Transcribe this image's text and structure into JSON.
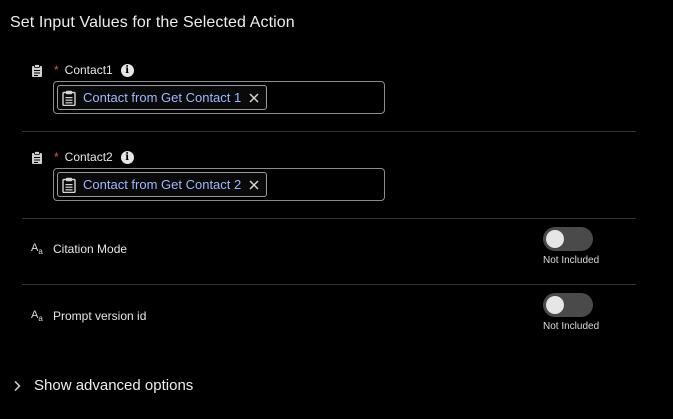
{
  "header": {
    "title": "Set Input Values for the Selected Action"
  },
  "fields": [
    {
      "label": "Contact1",
      "required_mark": "*",
      "info_glyph": "i",
      "icon": "clipboard-icon",
      "token": {
        "label": "Contact from Get Contact 1",
        "icon": "clipboard-icon",
        "remove_icon": "close-icon"
      }
    },
    {
      "label": "Contact2",
      "required_mark": "*",
      "info_glyph": "i",
      "icon": "clipboard-icon",
      "token": {
        "label": "Contact from Get Contact 2",
        "icon": "clipboard-icon",
        "remove_icon": "close-icon"
      }
    }
  ],
  "toggles": [
    {
      "label": "Citation Mode",
      "icon": "text-type-icon",
      "icon_text": "A",
      "icon_sub": "a",
      "checked": false,
      "status": "Not Included"
    },
    {
      "label": "Prompt version id",
      "icon": "text-type-icon",
      "icon_text": "A",
      "icon_sub": "a",
      "checked": false,
      "status": "Not Included"
    }
  ],
  "advanced": {
    "label": "Show advanced options",
    "icon": "chevron-right-icon"
  },
  "colors": {
    "background": "#000000",
    "token_text": "#9fb8ff",
    "required": "#e8524a",
    "toggle_off": "#4a4a4a"
  }
}
